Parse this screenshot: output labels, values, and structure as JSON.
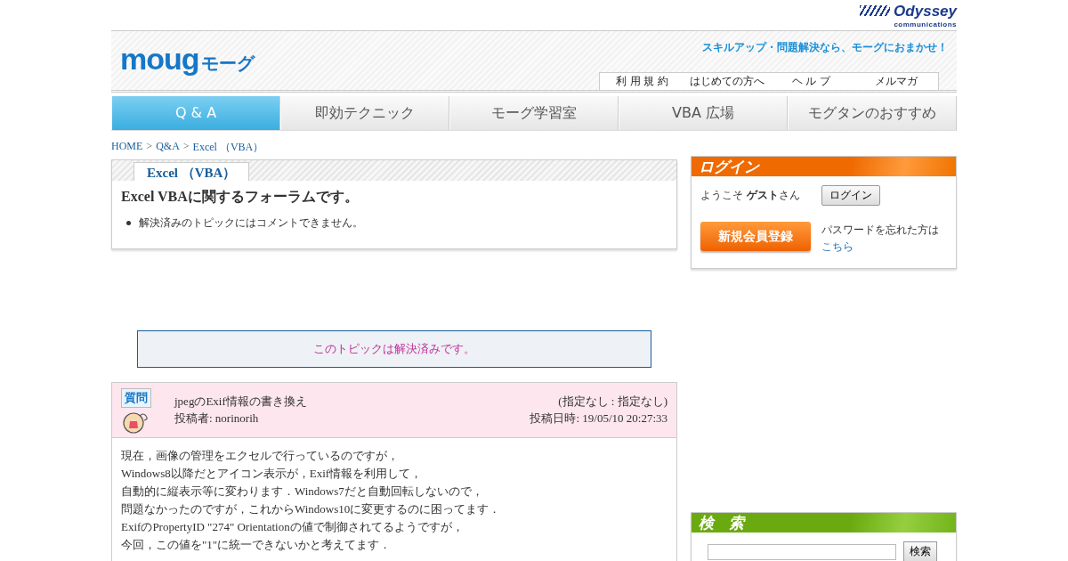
{
  "header": {
    "brand": "Odyssey",
    "brand_sub": "communications",
    "logo": "moug",
    "logo_kana": "モーグ",
    "tagline": "スキルアップ・問題解決なら、モーグにおまかせ！",
    "links": [
      "利 用 規 約",
      "はじめての方へ",
      "ヘ ル プ",
      "メルマガ"
    ]
  },
  "nav": [
    {
      "label": "Q & A",
      "selected": true
    },
    {
      "label": "即効テクニック",
      "selected": false
    },
    {
      "label": "モーグ学習室",
      "selected": false
    },
    {
      "label": "VBA 広場",
      "selected": false
    },
    {
      "label": "モグタンのおすすめ",
      "selected": false
    }
  ],
  "breadcrumb": {
    "items": [
      "HOME",
      "Q&A",
      "Excel （VBA）"
    ],
    "separator": ">"
  },
  "forum": {
    "tab": "Excel （VBA）",
    "title": "Excel VBAに関するフォーラムです。",
    "notes": [
      "解決済みのトピックにはコメントできません。"
    ]
  },
  "notice": "このトピックは解決済みです。",
  "post": {
    "badge": "質問",
    "title": "jpegのExif情報の書き換え",
    "author": "投稿者: norinorih",
    "category": "(指定なし : 指定なし)",
    "date": "投稿日時: 19/05/10 20:27:33",
    "body": [
      "現在，画像の管理をエクセルで行っているのですが，",
      "Windows8以降だとアイコン表示が，Exif情報を利用して，",
      "自動的に縦表示等に変わります．Windows7だと自動回転しないので，",
      "問題なかったのですが，これからWindows10に変更するのに困ってます．",
      "ExifのPropertyID \"274\" Orientationの値で制御されてるようですが，",
      "今回，この値を\"1\"に統一できないかと考えてます．"
    ]
  },
  "login": {
    "title": "ログイン",
    "welcome": "ようこそ **ゲスト**さん",
    "button": "ログイン",
    "register": "新規会員登録",
    "forgot": "パスワードを忘れた方は",
    "forgot_link": "こちら"
  },
  "search": {
    "title": "検　索",
    "button": "検索"
  }
}
